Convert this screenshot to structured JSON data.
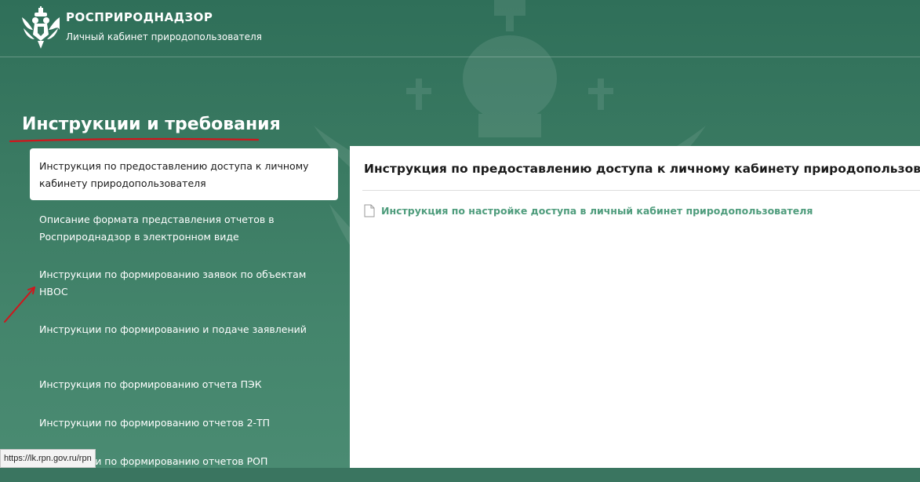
{
  "header": {
    "org_name": "РОСПРИРОДНАДЗОР",
    "org_subtitle": "Личный кабинет природопользователя"
  },
  "page": {
    "section_title": "Инструкции и требования"
  },
  "menu": {
    "items": [
      {
        "label": "Инструкция по предоставлению доступа к личному кабинету природопользователя",
        "active": true
      },
      {
        "label": "Описание формата представления отчетов в Росприроднадзор в электронном виде",
        "active": false
      },
      {
        "label": "Инструкции по формированию заявок по объектам НВОС",
        "active": false
      },
      {
        "label": "Инструкции по формированию и подаче заявлений",
        "active": false
      },
      {
        "label": "Инструкция по формированию отчета ПЭК",
        "active": false
      },
      {
        "label": "Инструкции по формированию отчетов 2-ТП",
        "active": false
      },
      {
        "label": "Инструкции по формированию отчетов РОП",
        "active": false
      }
    ]
  },
  "content": {
    "title": "Инструкция по предоставлению доступа к личному кабинету природопользователя",
    "documents": [
      {
        "label": "Инструкция по настройке доступа в личный кабинет природопользователя",
        "icon": "document-icon"
      }
    ]
  },
  "status_bar": {
    "url": "https://lk.rpn.gov.ru/rpn"
  },
  "colors": {
    "background": "#3a7560",
    "accent_link": "#4e9c7c",
    "annotation_red": "#d0161c"
  }
}
